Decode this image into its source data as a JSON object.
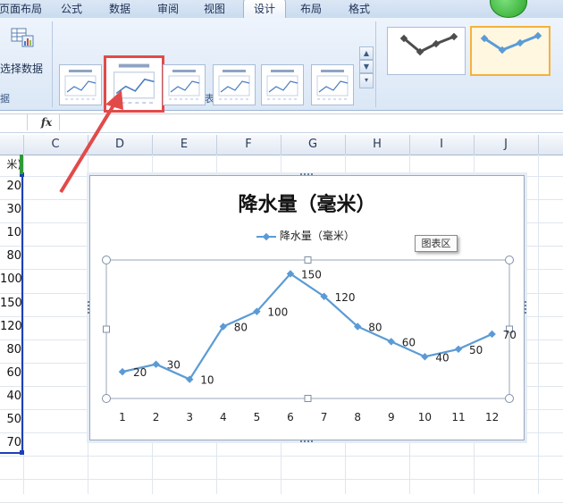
{
  "ribbon": {
    "tabs": [
      {
        "label": "页面布局"
      },
      {
        "label": "公式"
      },
      {
        "label": "数据"
      },
      {
        "label": "审阅"
      },
      {
        "label": "视图"
      },
      {
        "label": "设计",
        "active": true
      },
      {
        "label": "布局"
      },
      {
        "label": "格式"
      }
    ],
    "select_data_label": "选择数据",
    "left_group_label": "据",
    "chart_layout_group_label": "图表布局",
    "layout_count": 6,
    "selected_layout_index": 1,
    "style_count": 2,
    "selected_style_index": 1,
    "annotation_color": "#e24a4a"
  },
  "formula_bar": {
    "fx_label": "fx",
    "value": ""
  },
  "sheet": {
    "columns": [
      "C",
      "D",
      "E",
      "F",
      "G",
      "H",
      "I",
      "J"
    ],
    "b_column_header_partial": "米)",
    "b_column_values": [
      "20",
      "30",
      "10",
      "80",
      "100",
      "150",
      "120",
      "80",
      "60",
      "40",
      "50",
      "70"
    ]
  },
  "chart": {
    "tooltip": "图表区",
    "accent_color": "#5b9bd5"
  },
  "chart_data": {
    "type": "line",
    "title": "降水量（毫米）",
    "categories": [
      "1",
      "2",
      "3",
      "4",
      "5",
      "6",
      "7",
      "8",
      "9",
      "10",
      "11",
      "12"
    ],
    "series": [
      {
        "name": "降水量（毫米）",
        "values": [
          20,
          30,
          10,
          80,
          100,
          150,
          120,
          80,
          60,
          40,
          50,
          70
        ]
      }
    ],
    "data_labels": true,
    "grid": false,
    "legend_position": "top",
    "ylim": [
      0,
      160
    ]
  }
}
